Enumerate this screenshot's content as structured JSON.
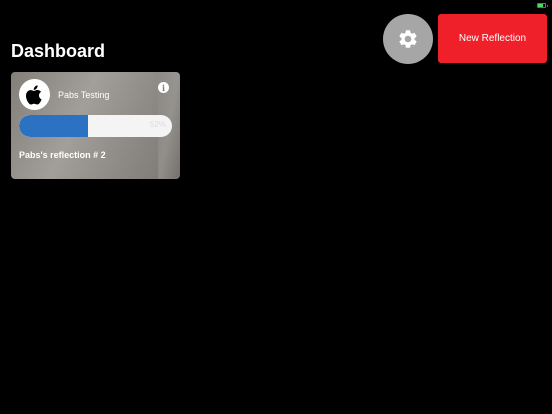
{
  "status_bar": {
    "battery_level": 0.7,
    "battery_color": "#4cd964"
  },
  "header": {
    "title": "Dashboard",
    "settings_icon": "gear-icon",
    "new_reflection_label": "New Reflection"
  },
  "cards": [
    {
      "group_name": "Pabs Testing",
      "avatar_icon": "apple-logo-icon",
      "info_icon": "info-icon",
      "info_glyph": "i",
      "progress": 0.45,
      "progress_label": "52%",
      "title": "Pabs's reflection # 2"
    }
  ],
  "colors": {
    "accent_red": "#f0202a",
    "progress_blue": "#2b73c2",
    "settings_gray": "#a6a6a6"
  }
}
